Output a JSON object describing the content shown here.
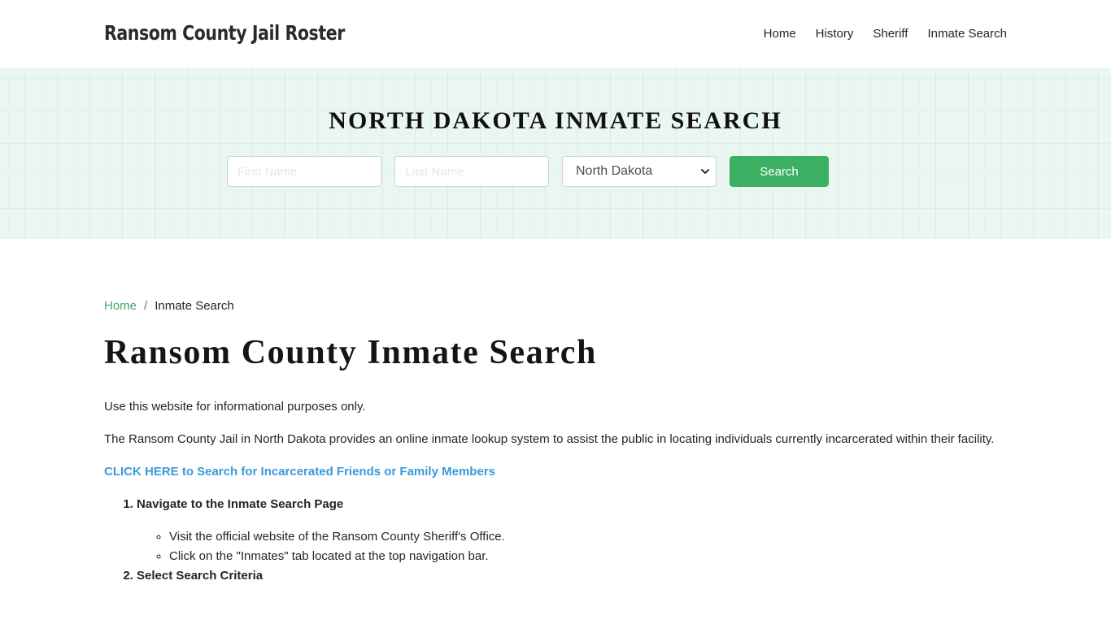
{
  "header": {
    "brand": "Ransom County Jail Roster",
    "nav": [
      {
        "label": "Home"
      },
      {
        "label": "History"
      },
      {
        "label": "Sheriff"
      },
      {
        "label": "Inmate Search"
      }
    ]
  },
  "hero": {
    "title": "NORTH DAKOTA INMATE SEARCH",
    "first_name_placeholder": "First Name",
    "first_name_value": "",
    "last_name_placeholder": "Last Name",
    "last_name_value": "",
    "state_selected": "North Dakota",
    "search_label": "Search",
    "colors": {
      "accent": "#3cb062",
      "background": "#eaf7f0"
    }
  },
  "breadcrumb": {
    "home": "Home",
    "separator": "/",
    "current": "Inmate Search"
  },
  "main": {
    "title": "Ransom County Inmate Search",
    "para1": "Use this website for informational purposes only.",
    "para2": "The Ransom County Jail in North Dakota provides an online inmate lookup system to assist the public in locating individuals currently incarcerated within their facility.",
    "cta": "CLICK HERE to Search for Incarcerated Friends or Family Members",
    "steps": [
      {
        "title": "Navigate to the Inmate Search Page",
        "items": [
          "Visit the official website of the Ransom County Sheriff's Office.",
          "Click on the \"Inmates\" tab located at the top navigation bar."
        ]
      },
      {
        "title": "Select Search Criteria",
        "items": []
      }
    ],
    "colors": {
      "link": "#3a9ad9",
      "breadcrumb_link": "#3fa66a"
    }
  }
}
